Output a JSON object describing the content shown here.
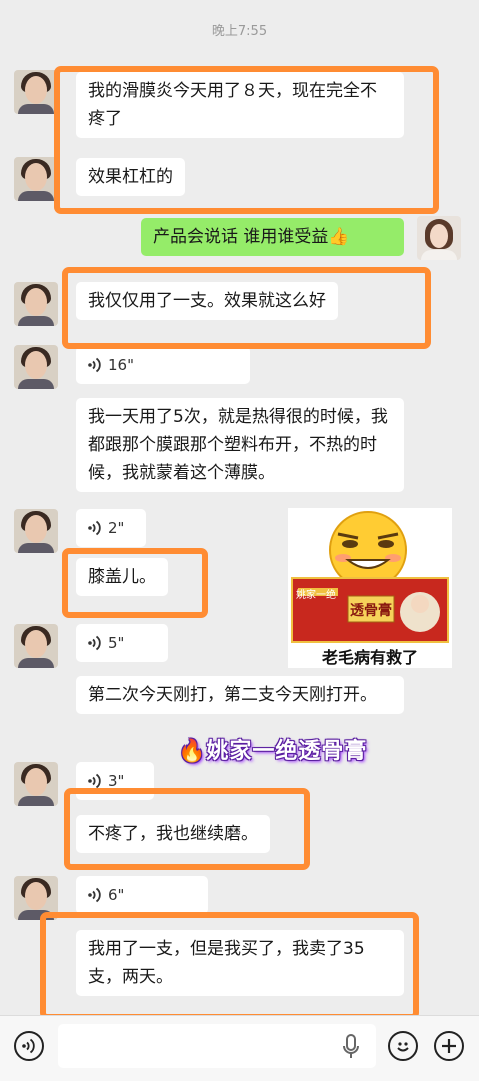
{
  "status": {
    "time": "晚上7:55"
  },
  "messages": {
    "m1": "我的滑膜炎今天用了８天，现在完全不疼了",
    "m2": "效果杠杠的",
    "m3": "产品会说话  谁用谁受益👍",
    "m4": "我仅仅用了一支。效果就这么好",
    "v1": "16\"",
    "m5": "我一天用了5次，就是热得很的时候，我都跟那个膜跟那个塑料布开，不热的时候，我就蒙着这个薄膜。",
    "v2": "2\"",
    "m6": "膝盖儿。",
    "v3": "5\"",
    "m7": "第二次今天刚打，第二支今天刚打开。",
    "v4": "3\"",
    "m8": "不疼了，我也继续磨。",
    "v5": "6\"",
    "m9": "我用了一支，但是我买了，我卖了35支，两天。"
  },
  "sticker": {
    "box_label": "透骨膏",
    "box_brand": "姚家一绝",
    "caption": "老毛病有救了"
  },
  "overlay": {
    "caption": "🔥姚家一绝透骨膏"
  },
  "colors": {
    "highlight": "#ff8c33",
    "self_bubble": "#95ec69",
    "other_bubble": "#ffffff",
    "background": "#ededed"
  },
  "input_bar": {
    "voice_toggle_icon": "voice-icon",
    "mic_icon": "microphone-icon",
    "emoji_icon": "emoji-icon",
    "more_icon": "plus-icon"
  }
}
